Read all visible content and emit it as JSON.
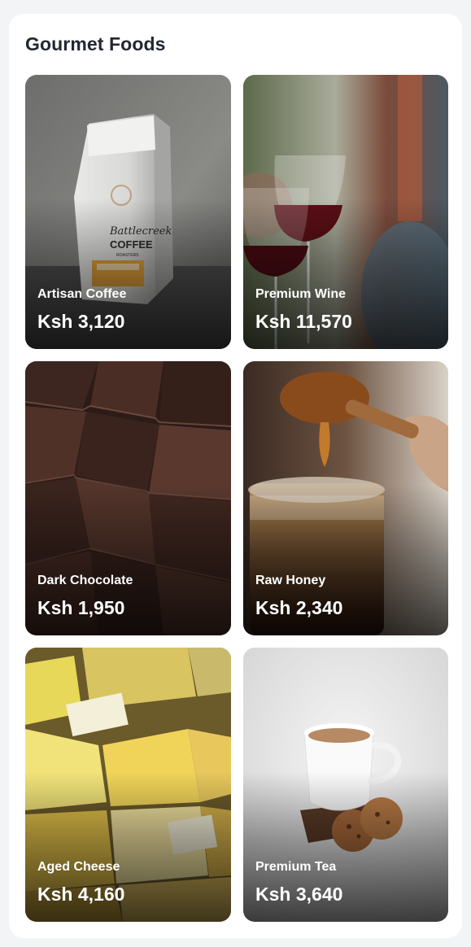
{
  "section": {
    "title": "Gourmet Foods"
  },
  "products": [
    {
      "name": "Artisan Coffee",
      "price": "Ksh 3,120",
      "image": "coffee-bag-image"
    },
    {
      "name": "Premium Wine",
      "price": "Ksh 11,570",
      "image": "wine-glasses-image"
    },
    {
      "name": "Dark Chocolate",
      "price": "Ksh 1,950",
      "image": "dark-chocolate-image"
    },
    {
      "name": "Raw Honey",
      "price": "Ksh 2,340",
      "image": "honey-jar-image"
    },
    {
      "name": "Aged Cheese",
      "price": "Ksh 4,160",
      "image": "cheese-display-image"
    },
    {
      "name": "Premium Tea",
      "price": "Ksh 3,640",
      "image": "tea-cup-image"
    }
  ],
  "colors": {
    "background": "#f3f4f6",
    "panel": "#ffffff",
    "title": "#232733",
    "card_text": "#ffffff"
  }
}
